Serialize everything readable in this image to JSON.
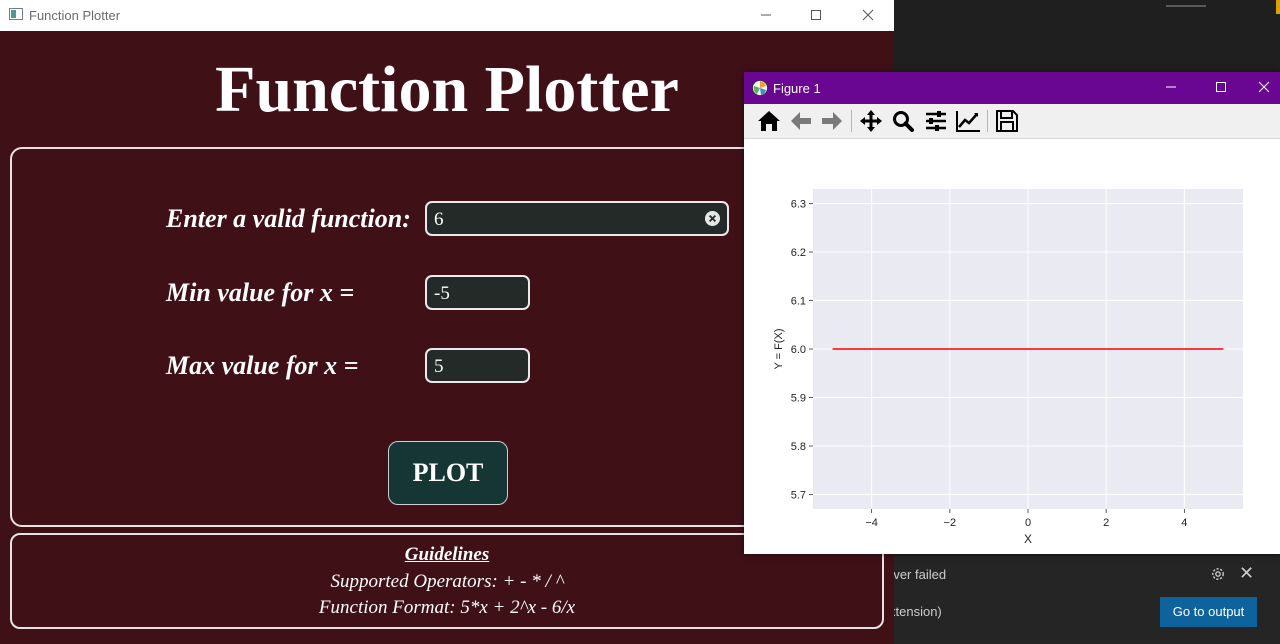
{
  "function_plotter": {
    "window_title": "Function Plotter",
    "heading": "Function Plotter",
    "function_label": "Enter a valid function:",
    "function_value": "6",
    "min_label": "Min value for x =",
    "min_value": "-5",
    "max_label": "Max value for x =",
    "max_value": "5",
    "plot_button": "PLOT",
    "guidelines": {
      "title": "Guidelines",
      "operators": "Supported Operators: + - * / ^",
      "format": "Function Format: 5*x + 2^x - 6/x"
    },
    "colors": {
      "background": "#3f1117",
      "input_bg": "#232a28",
      "button_bg": "#163636"
    }
  },
  "figure": {
    "window_title": "Figure 1",
    "toolbar": [
      "home-icon",
      "back-icon",
      "forward-icon",
      "pan-icon",
      "zoom-icon",
      "configure-subplots-icon",
      "edit-axis-icon",
      "save-icon"
    ],
    "title_bar_color": "#6a0792"
  },
  "chart_data": {
    "type": "line",
    "title": "",
    "xlabel": "X",
    "ylabel": "Y = F(X)",
    "xlim": [
      -5.5,
      5.5
    ],
    "ylim": [
      5.67,
      6.33
    ],
    "x_ticks": [
      -4,
      -2,
      0,
      2,
      4
    ],
    "x_tick_labels": [
      "−4",
      "−2",
      "0",
      "2",
      "4"
    ],
    "y_ticks": [
      5.7,
      5.8,
      5.9,
      6.0,
      6.1,
      6.2,
      6.3
    ],
    "y_tick_labels": [
      "5.7",
      "5.8",
      "5.9",
      "6.0",
      "6.1",
      "6.2",
      "6.3"
    ],
    "grid": true,
    "series": [
      {
        "color": "#ff0000",
        "x": [
          -5,
          5
        ],
        "y": [
          6,
          6
        ]
      }
    ]
  },
  "background_editor": {
    "notification_message": "rver failed",
    "notification_source": "xtension)",
    "go_to_output_button": "Go to output"
  }
}
